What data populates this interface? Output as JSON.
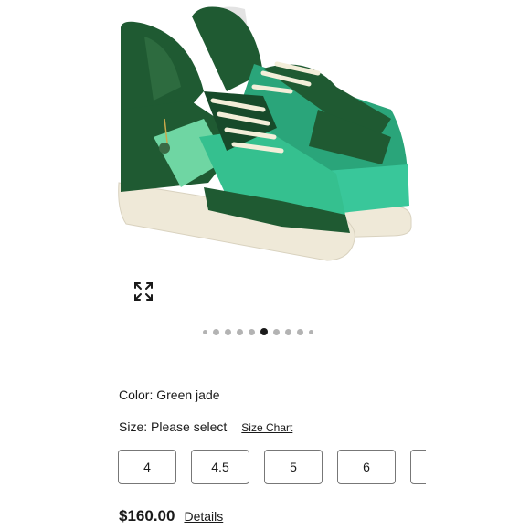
{
  "product": {
    "image_alt": "Green jade sneakers",
    "color_label": "Color:",
    "color_value": "Green jade",
    "size_label": "Size:",
    "size_value": "Please select",
    "size_chart_link": "Size Chart",
    "sizes": [
      "4",
      "4.5",
      "5",
      "6",
      ""
    ],
    "price": "$160.00",
    "details_link": "Details"
  },
  "gallery": {
    "image_count": 10,
    "active_index": 5
  },
  "colors": {
    "shoe_dark_green": "#1f5a32",
    "shoe_teal": "#2fbf8a",
    "sole": "#efe9d8",
    "text": "#1a1a1a"
  }
}
